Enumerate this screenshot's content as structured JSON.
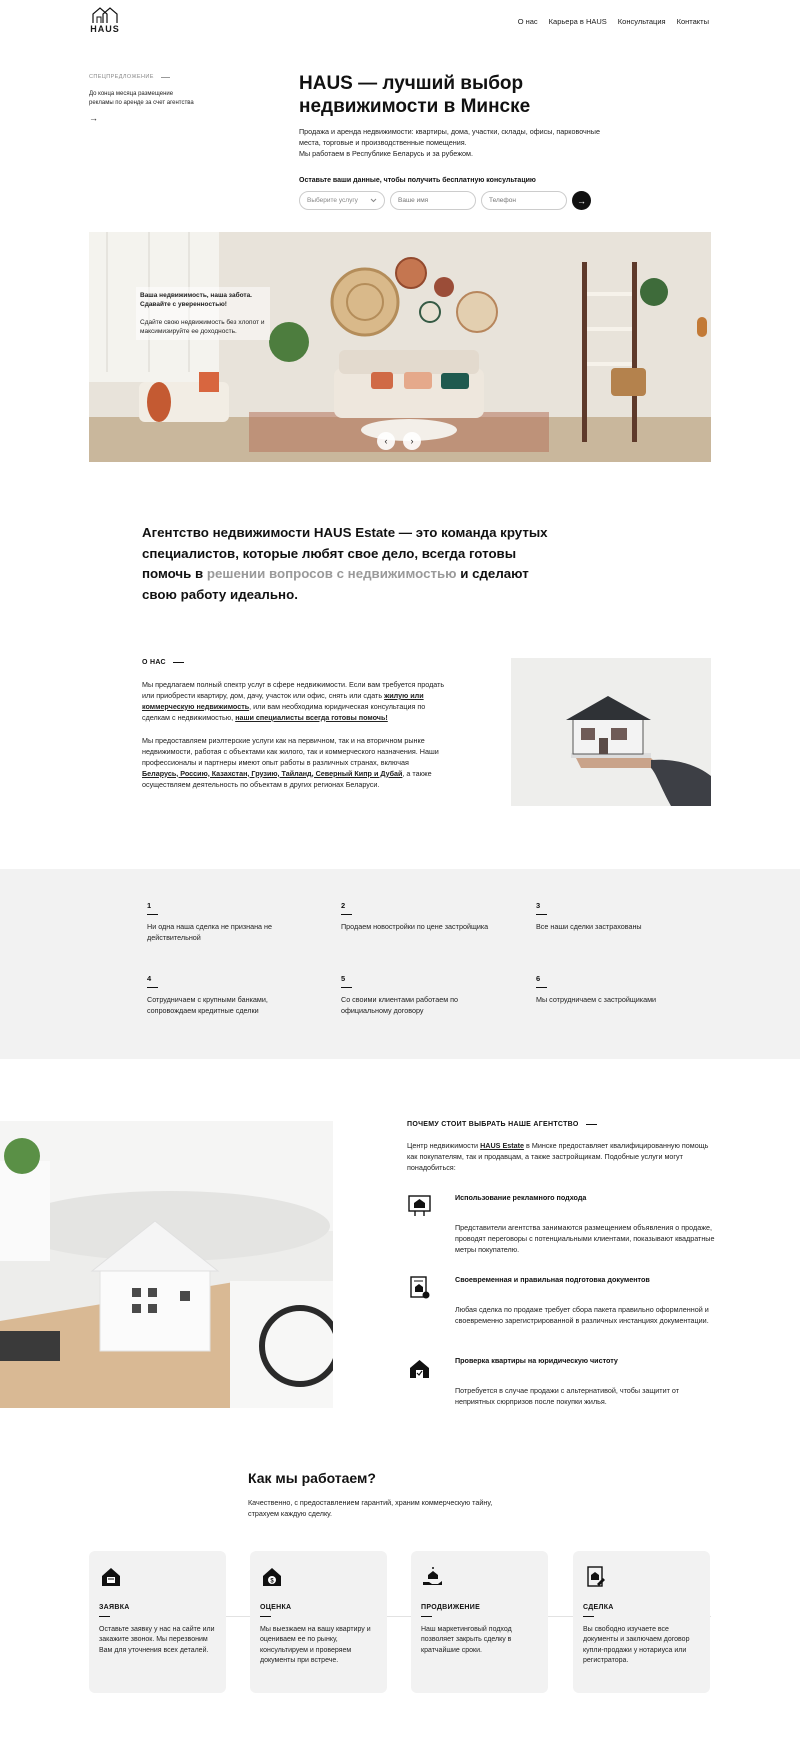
{
  "header": {
    "logo_text": "HAUS",
    "nav": [
      "О нас",
      "Карьера в HAUS",
      "Консультация",
      "Контакты"
    ]
  },
  "promo": {
    "label": "СПЕЦПРЕДЛОЖЕНИЕ",
    "text": "До конца месяца размещение рекламы по аренде за счет агентства",
    "arrow": "→"
  },
  "hero": {
    "title": "HAUS — лучший выбор недвижимости в Минске",
    "desc_line1": "Продажа и аренда недвижимости: квартиры, дома, участки, склады, офисы, парковочные места, торговые и производственные помещения.",
    "desc_line2": "Мы работаем в Республике Беларусь и за рубежом.",
    "form_label": "Оставьте ваши данные, чтобы получить бесплатную консультацию",
    "select_placeholder": "Выберите услугу",
    "name_placeholder": "Ваше имя",
    "phone_placeholder": "Телефон",
    "submit_icon": "→",
    "card_title": "Ваша недвижимость, наша забота. Сдавайте с уверенностью!",
    "card_text": "Сдайте свою недвижимость без хлопот и максимизируйте ее доходность.",
    "prev": "‹",
    "next": "›"
  },
  "statement": {
    "part1": "Агентство недвижимости HAUS Estate — это команда крутых специалистов, которые любят свое дело, всегда готовы помочь в ",
    "highlight": "решении вопросов с недвижимостью",
    "part2": " и сделают свою работу идеально."
  },
  "about": {
    "heading": "О НАС",
    "p1_a": "Мы предлагаем полный спектр услуг в сфере недвижимости. Если вам требуется продать или приобрести квартиру, дом, дачу, участок или офис, снять или сдать ",
    "p1_link": "жилую или коммерческую недвижимость",
    "p1_b": ", или вам необходима юридическая консультация по сделкам с недвижимостью, ",
    "p1_link2": "наши специалисты всегда готовы помочь!",
    "p2_a": "Мы предоставляем риэлтерские услуги как на первичном, так и на вторичном рынке недвижимости, работая с объектами как жилого, так и коммерческого назначения. Наши профессионалы и партнеры имеют опыт работы в различных странах, включая ",
    "p2_link": "Беларусь, Россию, Казахстан, Грузию, Тайланд, Северный Кипр и Дубай",
    "p2_b": ", а также осуществляем деятельность по объектам в других регионах Беларуси."
  },
  "features": [
    {
      "num": "1",
      "text": "Ни одна наша сделка не признана не действительной"
    },
    {
      "num": "2",
      "text": "Продаем новостройки по цене застройщика"
    },
    {
      "num": "3",
      "text": "Все наши сделки застрахованы"
    },
    {
      "num": "4",
      "text": "Сотрудничаем с крупными банками, сопровождаем кредитные сделки"
    },
    {
      "num": "5",
      "text": "Со своими клиентами работаем по официальному договору"
    },
    {
      "num": "6",
      "text": "Мы сотрудничаем с застройщиками"
    }
  ],
  "why": {
    "heading": "ПОЧЕМУ СТОИТ ВЫБРАТЬ НАШЕ АГЕНТСТВО",
    "lead_a": "Центр недвижимости ",
    "lead_link": "HAUS Estate",
    "lead_b": " в Минске предоставляет квалифицированную помощь как покупателям, так и продавцам, а также застройщикам. Подобные услуги могут понадобиться:",
    "items": [
      {
        "icon": "billboard-house-icon",
        "title": "Использование рекламного подхода",
        "desc": "Представители агентства занимаются размещением объявления о продаже, проводят переговоры с потенциальными клиентами, показывают квадратные метры покупателю."
      },
      {
        "icon": "document-house-icon",
        "title": "Своевременная и правильная подготовка документов",
        "desc": "Любая сделка по продаже требует сбора пакета правильно оформленной и своевременно зарегистрированной в различных инстанциях документации."
      },
      {
        "icon": "house-check-icon",
        "title": "Проверка квартиры на юридическую чистоту",
        "desc": "Потребуется в случае продажи с альтернативой, чтобы защитит от неприятных сюрпризов после покупки жилья."
      }
    ]
  },
  "how": {
    "title": "Как мы работаем?",
    "subtitle": "Качественно, с предоставлением гарантий, храним коммерческую тайну, страхуем каждую сделку.",
    "steps": [
      {
        "icon": "house-request-icon",
        "title": "ЗАЯВКА",
        "text": "Оставьте заявку у нас на сайте или закажите звонок. Мы перезвоним Вам для уточнения всех деталей."
      },
      {
        "icon": "house-price-icon",
        "title": "ОЦЕНКА",
        "text": "Мы выезжаем на вашу квартиру и оцениваем ее по рынку, консультируем и проверяем документы при встрече."
      },
      {
        "icon": "hand-house-icon",
        "title": "ПРОДВИЖЕНИЕ",
        "text": "Наш маркетинговый подход позволяет закрыть сделку в кратчайшие сроки."
      },
      {
        "icon": "contract-house-icon",
        "title": "СДЕЛКА",
        "text": "Вы свободно изучаете все документы и заключаем договор купли-продажи у нотариуса или регистратора."
      }
    ]
  }
}
